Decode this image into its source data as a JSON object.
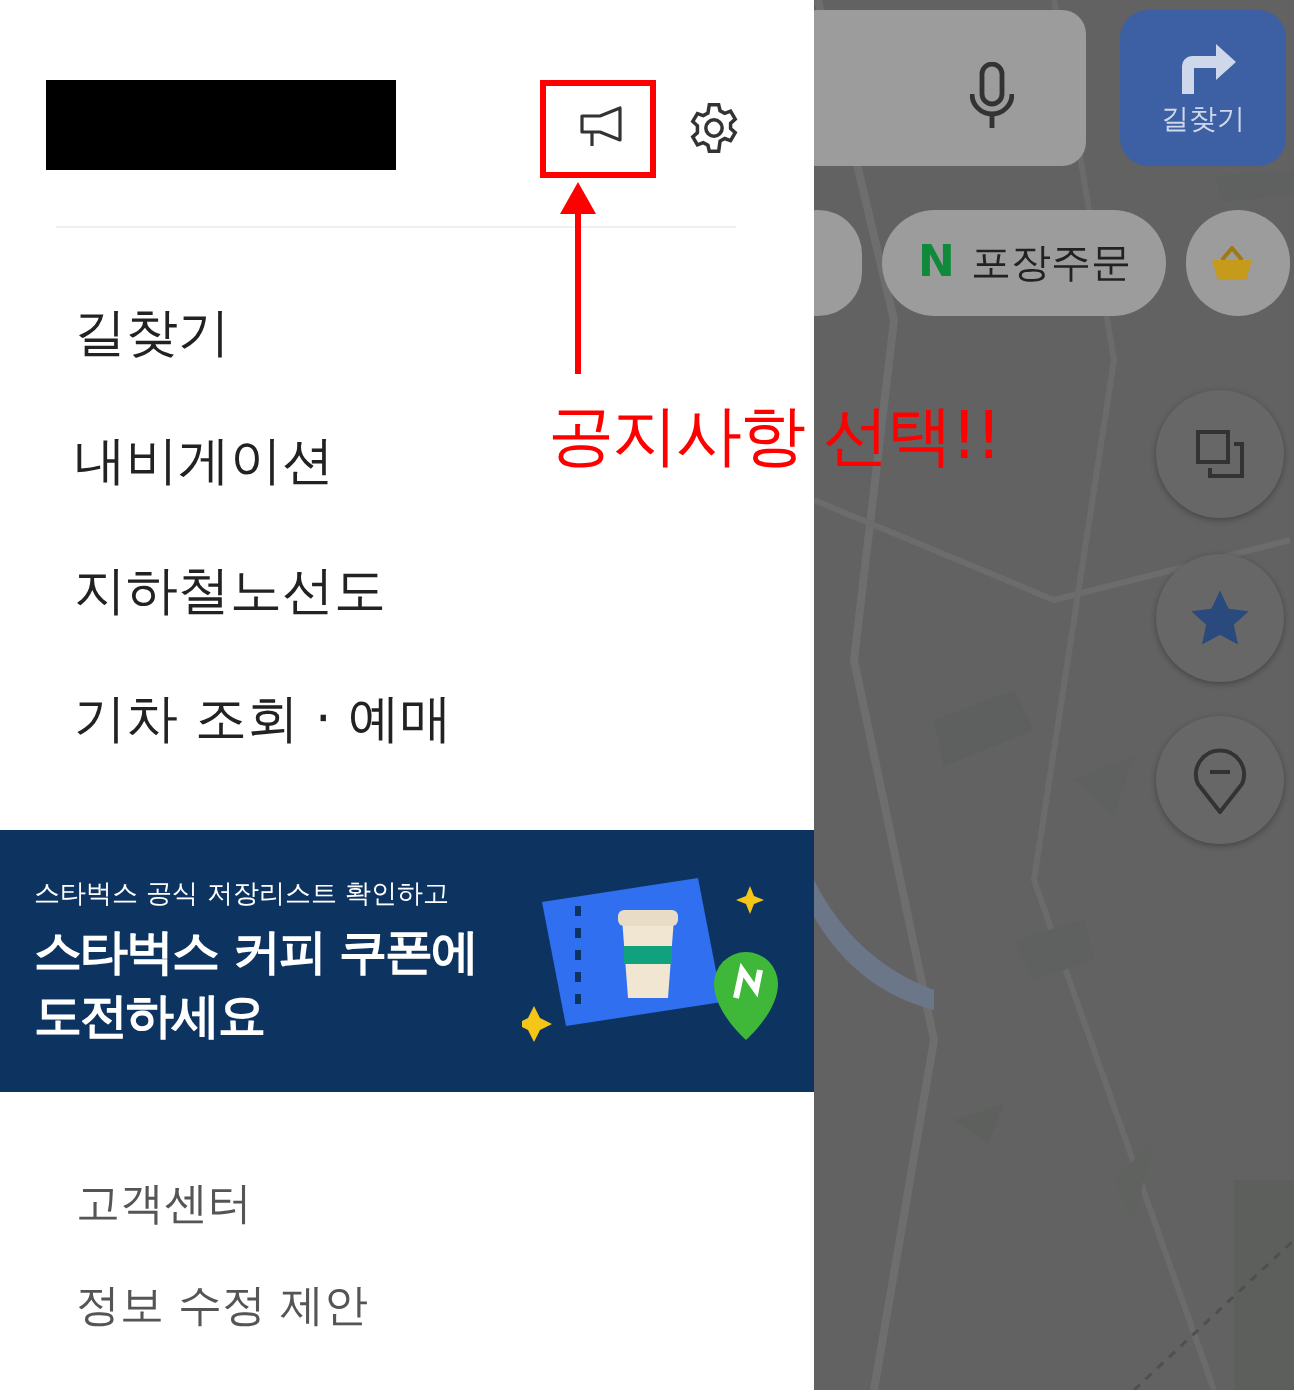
{
  "drawer": {
    "menu": [
      {
        "label": "길찾기"
      },
      {
        "label": "내비게이션"
      },
      {
        "label": "지하철노선도"
      },
      {
        "label": "기차 조회 · 예매"
      }
    ],
    "banner": {
      "subtitle": "스타벅스 공식 저장리스트 확인하고",
      "title_lines": [
        "스타벅스 커피 쿠폰에",
        "도전하세요"
      ]
    },
    "footer_links": [
      "고객센터",
      "정보 수정 제안"
    ]
  },
  "map": {
    "directions_button": "길찾기",
    "chips": [
      {
        "kind": "partial"
      },
      {
        "kind": "naver",
        "badge": "N",
        "label": "포장주문"
      },
      {
        "kind": "basket"
      }
    ]
  },
  "annotation": {
    "text": "공지사항 선택!!"
  }
}
